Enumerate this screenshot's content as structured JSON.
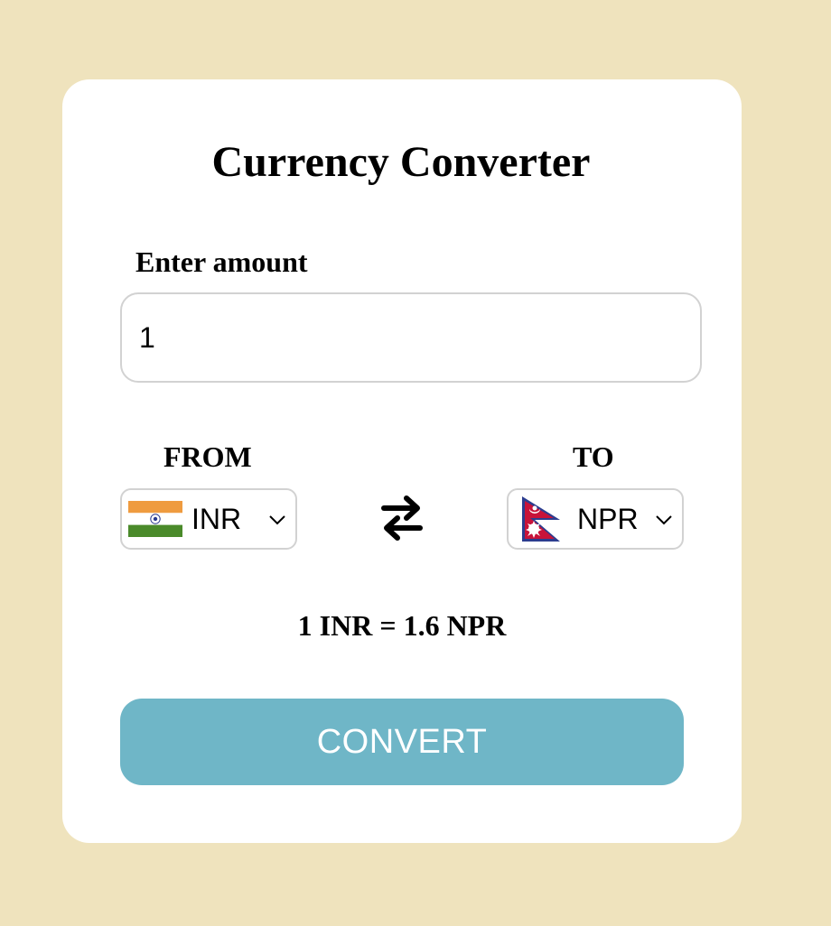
{
  "app": {
    "title": "Currency Converter"
  },
  "amount": {
    "label": "Enter amount",
    "value": "1"
  },
  "from": {
    "label": "FROM",
    "currency": "INR",
    "flag": "india-flag-icon"
  },
  "to": {
    "label": "TO",
    "currency": "NPR",
    "flag": "nepal-flag-icon"
  },
  "swap": {
    "icon": "swap-arrows-icon"
  },
  "rate": {
    "text": "1 INR = 1.6 NPR"
  },
  "actions": {
    "convert_label": "CONVERT"
  },
  "colors": {
    "background": "#efe3bd",
    "card": "#ffffff",
    "button": "#6fb6c7",
    "border": "#d2d2d2"
  }
}
